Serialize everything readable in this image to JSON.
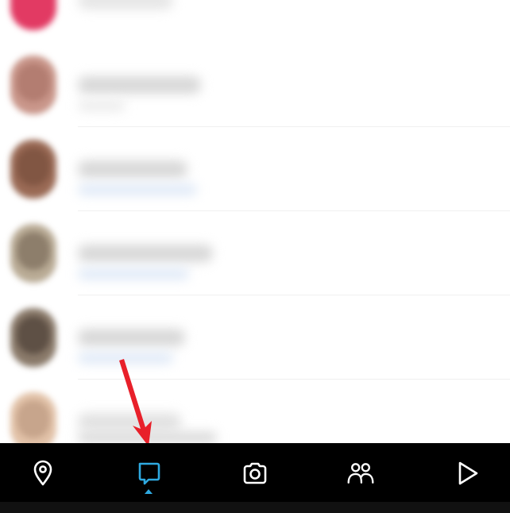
{
  "colors": {
    "navbar_bg": "#000000",
    "nav_icon": "#ffffff",
    "nav_active": "#2ea9e0",
    "annotation_arrow": "#e8202a"
  },
  "chat_list": {
    "rows": [
      {
        "avatar_color": "#e23a63",
        "blurred": true
      },
      {
        "avatar_color": "#b07866",
        "blurred": true
      },
      {
        "avatar_color": "#8a5a44",
        "blurred": true
      },
      {
        "avatar_color": "#7a6a55",
        "blurred": true
      },
      {
        "avatar_color": "#4a3a30",
        "blurred": true
      },
      {
        "avatar_color": "#c9a38a",
        "blurred": true
      }
    ]
  },
  "bottom_nav": {
    "items": [
      {
        "icon": "map-pin-icon",
        "active": false
      },
      {
        "icon": "chat-icon",
        "active": true
      },
      {
        "icon": "camera-icon",
        "active": false
      },
      {
        "icon": "friends-icon",
        "active": false
      },
      {
        "icon": "play-icon",
        "active": false
      }
    ]
  },
  "annotation": {
    "type": "arrow",
    "points_to": "chat-icon"
  }
}
